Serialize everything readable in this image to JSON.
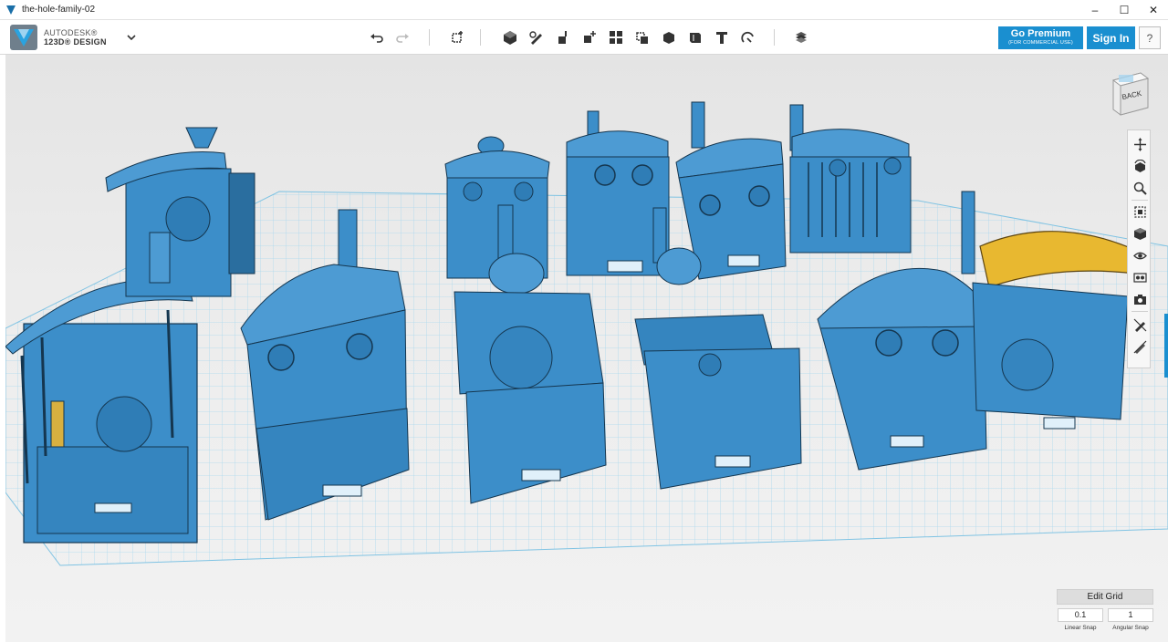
{
  "window": {
    "title": "the-hole-family-02",
    "minimize_label": "–",
    "maximize_label": "☐",
    "close_label": "✕"
  },
  "brand": {
    "line1": "AUTODESK®",
    "line2": "123D® DESIGN"
  },
  "toolbar": {
    "tools": [
      "undo-icon",
      "redo-icon",
      "transform-icon",
      "primitives-icon",
      "sketch-icon",
      "construct-icon",
      "modify-icon",
      "pattern-icon",
      "grouping-icon",
      "combine-icon",
      "measure-icon",
      "text-icon",
      "snap-icon",
      "material-icon"
    ],
    "premium_label": "Go Premium",
    "premium_sub": "(FOR COMMERCIAL USE)",
    "signin_label": "Sign In",
    "help_label": "?"
  },
  "viewcube": {
    "face_label": "BACK"
  },
  "navbar": {
    "items": [
      "pan-icon",
      "orbit-icon",
      "zoom-icon",
      "fit-icon",
      "view-cube-icon",
      "visibility-icon",
      "material-view-icon",
      "camera-icon",
      "hide-sketch-icon",
      "hide-mesh-icon"
    ]
  },
  "grid_panel": {
    "edit_grid_label": "Edit Grid",
    "linear_snap_value": "0.1",
    "angular_snap_value": "1",
    "linear_snap_label": "Linear Snap",
    "angular_snap_label": "Angular Snap"
  },
  "colors": {
    "accent": "#1a8fd0",
    "model_blue": "#3f8fca",
    "canopy_yellow": "#e8b830",
    "grid_line": "#8ecbe8",
    "background": "#e8e8e8"
  }
}
